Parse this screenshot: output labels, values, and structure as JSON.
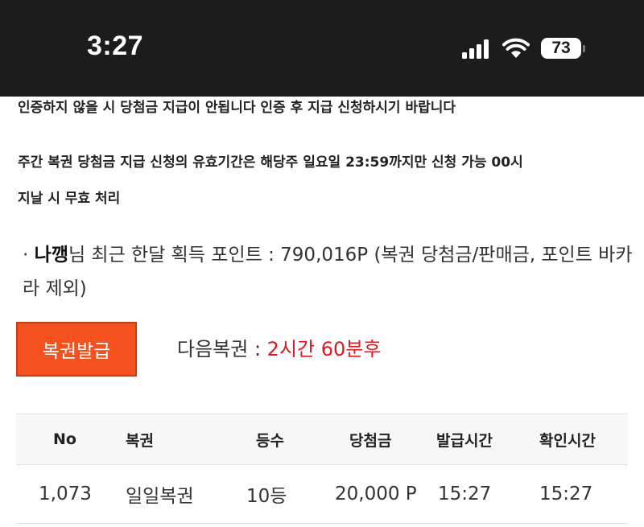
{
  "status_bar": {
    "time": "3:27",
    "battery_level": "73",
    "icons": [
      "cellular-signal-icon",
      "wifi-icon",
      "battery-icon"
    ]
  },
  "notices": {
    "line1": "인증하지 않을 시 당첨금 지급이 안됩니다 인증 후 지급 신청하시기 바랍니다",
    "line2": "주간 복권 당첨금 지급 신청의 유효기간은 해당주 일요일 23:59까지만 신청 가능 00시",
    "line3": "지날 시 무효 처리"
  },
  "points_info": {
    "bullet": "·",
    "nickname": "나깽",
    "text": "님 최근 한달 획득 포인트 : 790,016P (복권 당첨금/판매금, 포인트 바카라 제외)"
  },
  "issue_button_label": "복권발급",
  "next_lottery": {
    "label": "다음복권 : ",
    "time": "2시간 60분후"
  },
  "table": {
    "headers": [
      "No",
      "복권",
      "등수",
      "당첨금",
      "발급시간",
      "확인시간"
    ],
    "rows": [
      [
        "1,073",
        "일일복권",
        "10등",
        "20,000 P",
        "15:27",
        "15:27"
      ]
    ]
  },
  "colors": {
    "status_bar_bg": "#1c1c1c",
    "button_orange": "#f4511e",
    "accent_red": "#e0191e"
  }
}
